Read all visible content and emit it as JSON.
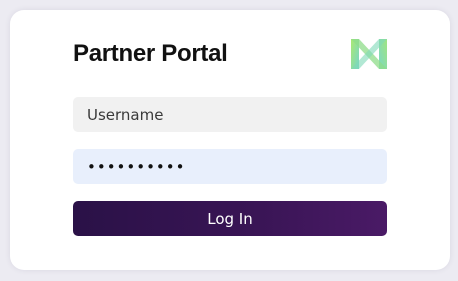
{
  "header": {
    "title": "Partner Portal",
    "logo_icon": "brand-logo-icon"
  },
  "form": {
    "username": {
      "value": "",
      "placeholder": "Username"
    },
    "password": {
      "value": "••••••••••",
      "placeholder": ""
    },
    "login_label": "Log In"
  },
  "colors": {
    "button_gradient_start": "#2a1147",
    "button_gradient_end": "#4a1a66",
    "logo_green": "#8be08a",
    "logo_teal": "#7fd6c8",
    "password_field_bg": "#e8effc",
    "username_field_bg": "#f1f1f1"
  }
}
